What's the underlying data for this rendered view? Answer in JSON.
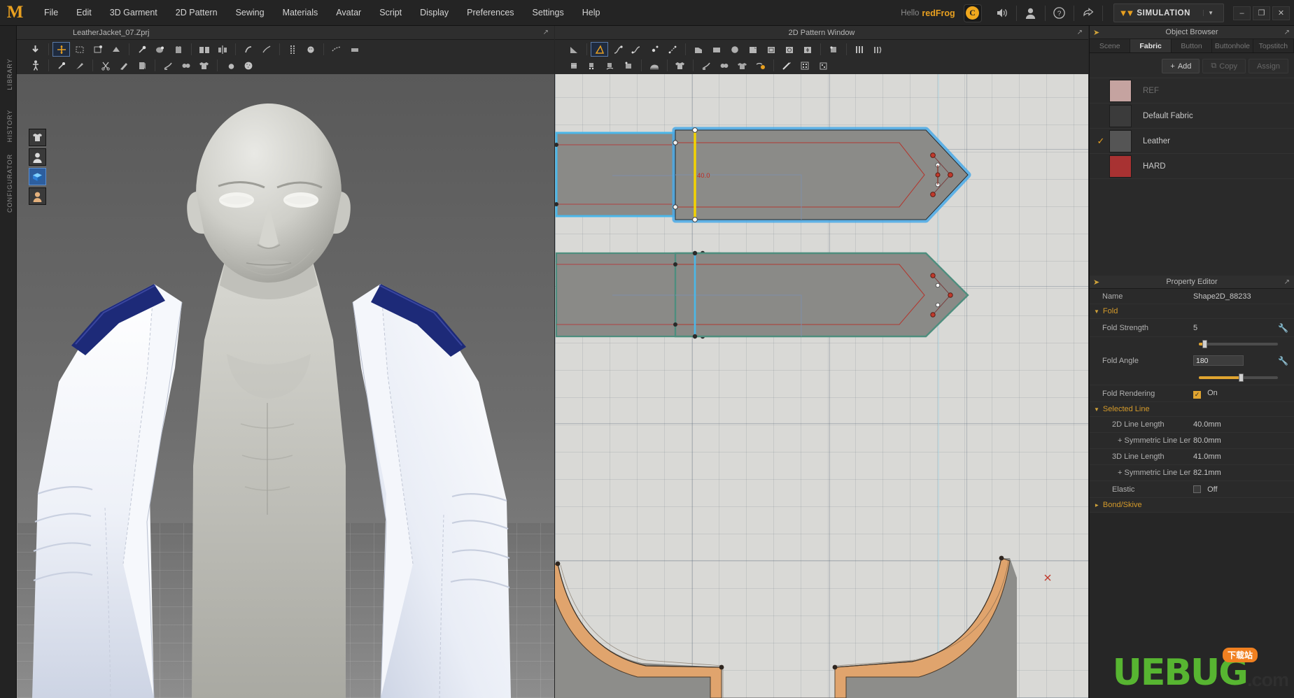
{
  "app": {
    "logo": "M",
    "menu": [
      "File",
      "Edit",
      "3D Garment",
      "2D Pattern",
      "Sewing",
      "Materials",
      "Avatar",
      "Script",
      "Display",
      "Preferences",
      "Settings",
      "Help"
    ],
    "hello_label": "Hello",
    "username": "redFrog",
    "cloud_icon": "cloud-icon",
    "sound_icon": "speaker-icon",
    "account_icon": "user-icon",
    "help_icon": "question-icon",
    "share_icon": "share-icon",
    "simulation_label": "SIMULATION",
    "sim_dropdown_icon": "chevron-down-icon",
    "window_minimize": "–",
    "window_restore": "❐",
    "window_close": "✕"
  },
  "left_rail": {
    "items": [
      "LIBRARY",
      "HISTORY",
      "CONFIGURATOR"
    ]
  },
  "view3d": {
    "title": "LeatherJacket_07.Zprj",
    "popout_icon": "popout-icon",
    "float_buttons": [
      {
        "name": "garment-visibility-toggle",
        "active": false
      },
      {
        "name": "avatar-visibility-toggle",
        "active": false
      },
      {
        "name": "fabric-visibility-toggle",
        "active": true
      },
      {
        "name": "skin-visibility-toggle",
        "active": false
      }
    ]
  },
  "view2d": {
    "title": "2D Pattern Window",
    "popout_icon": "popout-icon",
    "dimension_label": "40.0"
  },
  "object_browser": {
    "title": "Object Browser",
    "collapse_icon": "arrow-right-icon",
    "popout_icon": "popout-icon",
    "tabs": [
      {
        "label": "Scene",
        "active": false
      },
      {
        "label": "Fabric",
        "active": true
      },
      {
        "label": "Button",
        "active": false
      },
      {
        "label": "Buttonhole",
        "active": false
      },
      {
        "label": "Topstitch",
        "active": false
      }
    ],
    "actions": [
      {
        "label": "Add",
        "icon": "plus-icon",
        "enabled": true
      },
      {
        "label": "Copy",
        "icon": "copy-icon",
        "enabled": false
      },
      {
        "label": "Assign",
        "icon": "assign-icon",
        "enabled": false
      }
    ],
    "fabrics": [
      {
        "name": "REF",
        "color": "#c5a3a0",
        "selected": false,
        "dim": true
      },
      {
        "name": "Default Fabric",
        "color": "#3b3b3b",
        "selected": false,
        "dim": false
      },
      {
        "name": "Leather",
        "color": "#555555",
        "selected": true,
        "dim": false
      },
      {
        "name": "HARD",
        "color": "#a83232",
        "selected": false,
        "dim": false
      }
    ]
  },
  "property_editor": {
    "title": "Property Editor",
    "collapse_icon": "arrow-right-icon",
    "popout_icon": "popout-icon",
    "name_label": "Name",
    "name_value": "Shape2D_88233",
    "groups": {
      "fold": {
        "label": "Fold",
        "expanded": true,
        "fold_strength": {
          "label": "Fold Strength",
          "value": "5",
          "slider_pct": 6,
          "wrench_icon": "wrench-icon"
        },
        "fold_angle": {
          "label": "Fold Angle",
          "value": "180",
          "slider_pct": 52,
          "wrench_icon": "wrench-icon"
        },
        "fold_rendering": {
          "label": "Fold Rendering",
          "value": "On",
          "checked": true
        }
      },
      "selected_line": {
        "label": "Selected Line",
        "expanded": true,
        "rows": [
          {
            "label": "2D Line Length",
            "value": "40.0mm",
            "indent": 1
          },
          {
            "label": "+ Symmetric Line Ler",
            "value": "80.0mm",
            "indent": 2
          },
          {
            "label": "3D Line Length",
            "value": "41.0mm",
            "indent": 1
          },
          {
            "label": "+ Symmetric Line Ler",
            "value": "82.1mm",
            "indent": 2
          }
        ],
        "elastic": {
          "label": "Elastic",
          "value": "Off",
          "checked": false
        }
      },
      "bond_skive": {
        "label": "Bond/Skive",
        "expanded": false
      }
    }
  },
  "watermark": {
    "brand": "UEBUG",
    "domain": ".com",
    "tag": "下载站"
  },
  "colors": {
    "accent": "#e0a430",
    "selection_blue": "#49a9e8",
    "fold_line_yellow": "#f5d400",
    "dimension_red": "#c83020",
    "panel_bg": "#2a2a2a"
  }
}
